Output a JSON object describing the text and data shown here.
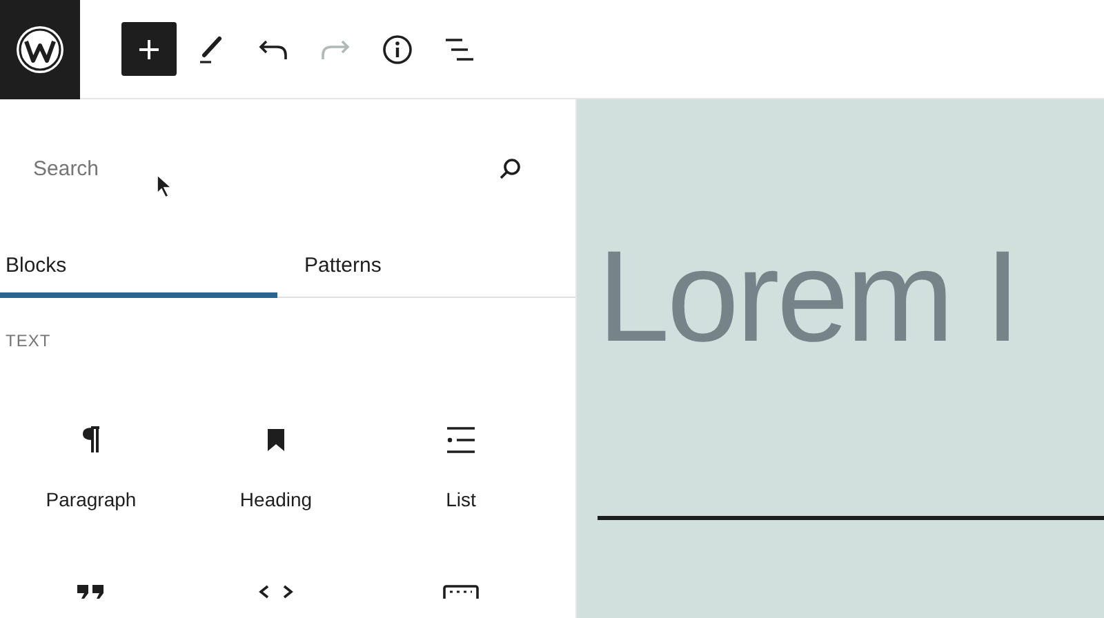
{
  "toolbar": [
    {
      "kind": "add",
      "pressed": true,
      "disabled": false
    },
    {
      "kind": "edit",
      "pressed": false,
      "disabled": false
    },
    {
      "kind": "undo",
      "pressed": false,
      "disabled": false
    },
    {
      "kind": "redo",
      "pressed": false,
      "disabled": true
    },
    {
      "kind": "info",
      "pressed": false,
      "disabled": false
    },
    {
      "kind": "outline",
      "pressed": false,
      "disabled": false
    }
  ],
  "inserter": {
    "search": {
      "placeholder": "Search"
    },
    "tabs": [
      {
        "label": "Blocks",
        "selected": true
      },
      {
        "label": "Patterns",
        "selected": false
      }
    ],
    "category": "TEXT",
    "blocks": [
      {
        "kind": "paragraph",
        "label": "Paragraph"
      },
      {
        "kind": "heading",
        "label": "Heading"
      },
      {
        "kind": "list",
        "label": "List"
      },
      {
        "kind": "quote"
      },
      {
        "kind": "code"
      },
      {
        "kind": "preformatted"
      }
    ]
  },
  "canvas": {
    "heading": "Lorem I"
  }
}
